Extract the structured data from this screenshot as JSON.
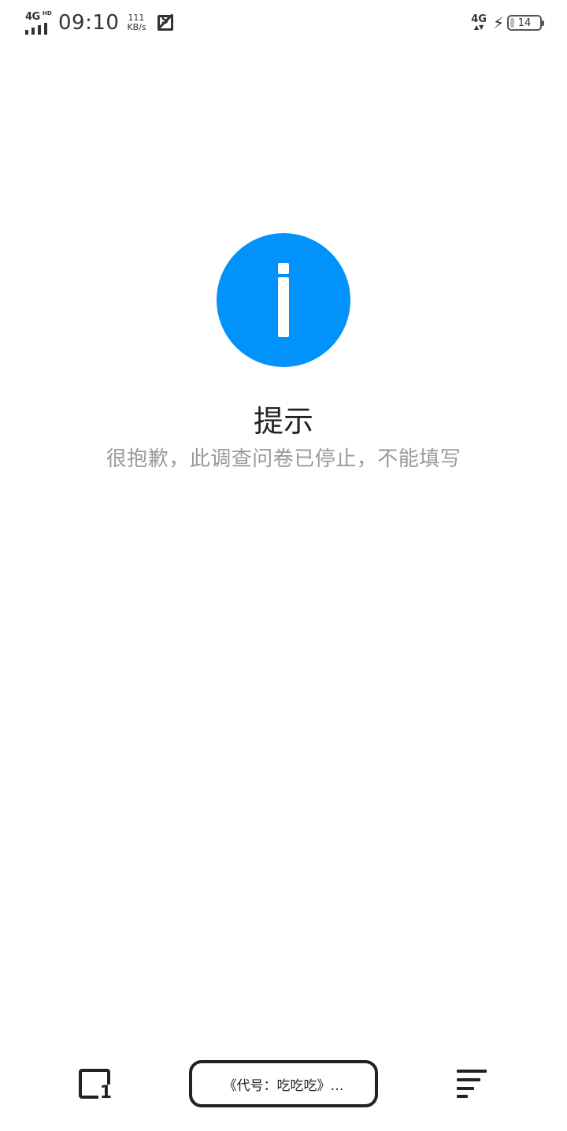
{
  "status_bar": {
    "network_left": "4G",
    "hd_badge": "HD",
    "time": "09:10",
    "speed_value": "111",
    "speed_unit": "KB/s",
    "network_right": "4G",
    "battery_level": "14",
    "battery_fraction": 0.14,
    "icons": [
      "signal-icon",
      "screenshot-icon",
      "data-activity-icon",
      "charging-icon",
      "battery-icon"
    ]
  },
  "main": {
    "icon": "info-icon",
    "icon_color": "#0292fb",
    "title": "提示",
    "message": "很抱歉，此调查问卷已停止，不能填写"
  },
  "bottom_bar": {
    "tab_count": "1",
    "address_text": "《代号：吃吃吃》…",
    "icons": [
      "tabs-icon",
      "menu-icon"
    ]
  }
}
